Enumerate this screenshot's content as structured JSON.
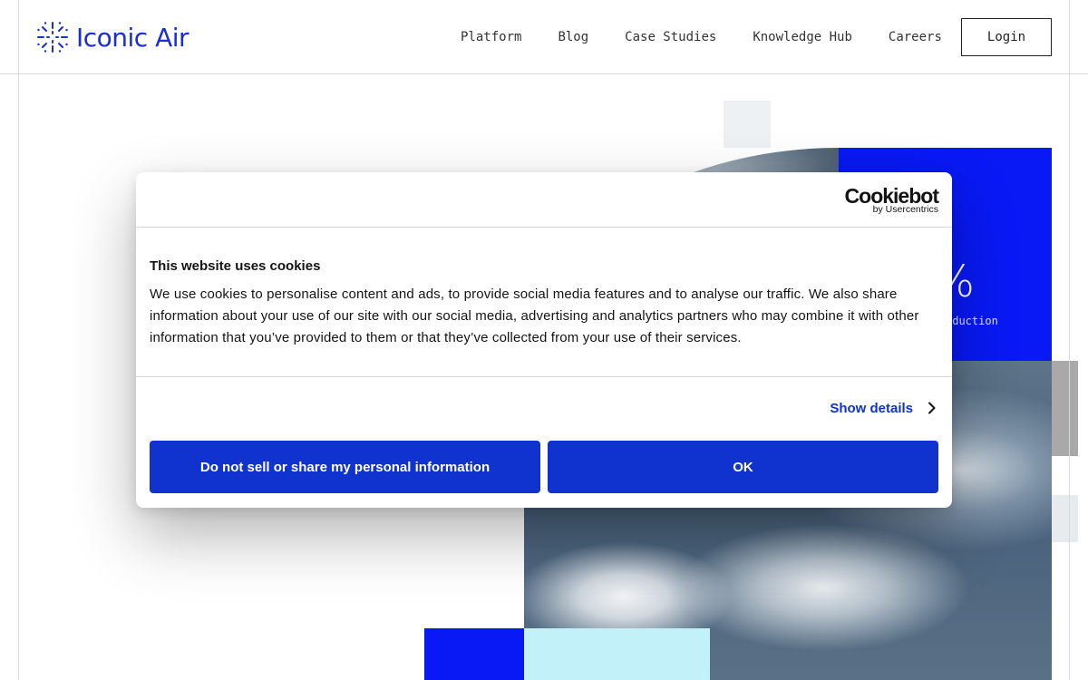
{
  "header": {
    "logo_text": "Iconic Air",
    "nav": [
      "Platform",
      "Blog",
      "Case Studies",
      "Knowledge Hub",
      "Careers"
    ],
    "login_label": "Login"
  },
  "hero": {
    "stat_value": "%",
    "stat_label": "eduction",
    "brand_blue": "#0819f5",
    "accent_cyan": "#c2f1f9"
  },
  "cookie_dialog": {
    "logo_word": "Cookiebot",
    "logo_sub": "by Usercentrics",
    "title": "This website uses cookies",
    "body": "We use cookies to personalise content and ads, to provide social media features and to analyse our traffic. We also share information about your use of our site with our social media, advertising and analytics partners who may combine it with other information that you’ve provided to them or that they’ve collected from your use of their services.",
    "show_details": "Show details",
    "deny_label": "Do not sell or share my personal information",
    "ok_label": "OK",
    "button_color": "#1032cf"
  },
  "icons": {
    "logo": "iconic-air-logo-icon",
    "show_details": "chevron-right-icon"
  }
}
